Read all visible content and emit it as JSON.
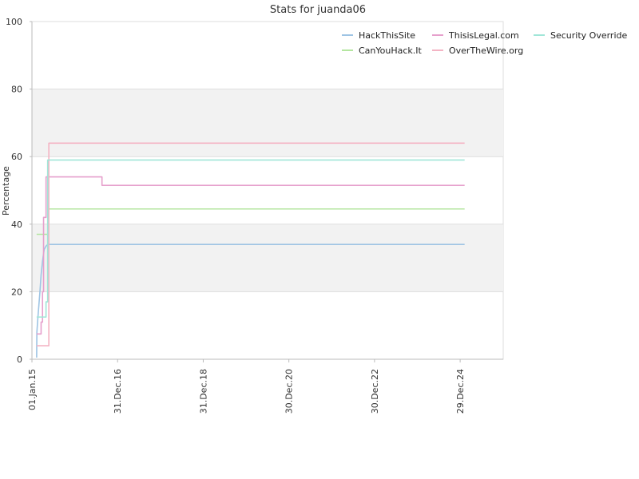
{
  "chart_data": {
    "type": "line",
    "title": "Stats for juanda06",
    "xlabel": "",
    "ylabel": "Percentage",
    "ylim": [
      0,
      100
    ],
    "xlim": [
      "2015-01-01",
      "2025-12-31"
    ],
    "y_ticks": [
      0,
      20,
      40,
      60,
      80,
      100
    ],
    "x_ticks": [
      {
        "date": "2015-01-01",
        "label": "01.Jan.15"
      },
      {
        "date": "2016-12-31",
        "label": "31.Dec.16"
      },
      {
        "date": "2018-12-31",
        "label": "31.Dec.18"
      },
      {
        "date": "2020-12-30",
        "label": "30.Dec.20"
      },
      {
        "date": "2022-12-30",
        "label": "30.Dec.22"
      },
      {
        "date": "2024-12-29",
        "label": "29.Dec.24"
      }
    ],
    "bands": [
      [
        20,
        40
      ],
      [
        60,
        80
      ]
    ],
    "band_color": "#f2f2f2",
    "grid": true,
    "legend_position": "top-right",
    "series": [
      {
        "name": "HackThisSite",
        "color": "#9ec4e4",
        "step": false,
        "points": [
          [
            "2015-02-10",
            0.5
          ],
          [
            "2015-02-12",
            8
          ],
          [
            "2015-02-20",
            12
          ],
          [
            "2015-03-01",
            16
          ],
          [
            "2015-03-10",
            20
          ],
          [
            "2015-03-20",
            25
          ],
          [
            "2015-04-01",
            29
          ],
          [
            "2015-04-15",
            32.5
          ],
          [
            "2015-05-01",
            33.5
          ],
          [
            "2015-05-15",
            34
          ],
          [
            "2025-02-05",
            34
          ]
        ]
      },
      {
        "name": "CanYouHack.It",
        "color": "#b4e6a0",
        "step": true,
        "points": [
          [
            "2015-02-10",
            37
          ],
          [
            "2015-05-20",
            44.5
          ],
          [
            "2025-02-05",
            44.5
          ]
        ]
      },
      {
        "name": "ThisisLegal.com",
        "color": "#e6a0cc",
        "step": true,
        "points": [
          [
            "2015-02-10",
            7.5
          ],
          [
            "2015-03-20",
            11
          ],
          [
            "2015-04-01",
            20
          ],
          [
            "2015-04-10",
            42
          ],
          [
            "2015-05-01",
            54
          ],
          [
            "2016-08-20",
            51.5
          ],
          [
            "2025-02-05",
            51.5
          ]
        ]
      },
      {
        "name": "OverTheWire.org",
        "color": "#f4b4c4",
        "step": true,
        "points": [
          [
            "2015-02-10",
            4
          ],
          [
            "2015-05-25",
            64
          ],
          [
            "2025-02-05",
            64
          ]
        ]
      },
      {
        "name": "Security Override",
        "color": "#a0e6d8",
        "step": true,
        "points": [
          [
            "2015-02-10",
            12.5
          ],
          [
            "2015-05-01",
            17
          ],
          [
            "2015-05-15",
            59
          ],
          [
            "2025-02-05",
            59
          ]
        ]
      }
    ],
    "legend_layout": [
      [
        "HackThisSite",
        "ThisisLegal.com",
        "Security Override"
      ],
      [
        "CanYouHack.It",
        "OverTheWire.org"
      ]
    ]
  }
}
